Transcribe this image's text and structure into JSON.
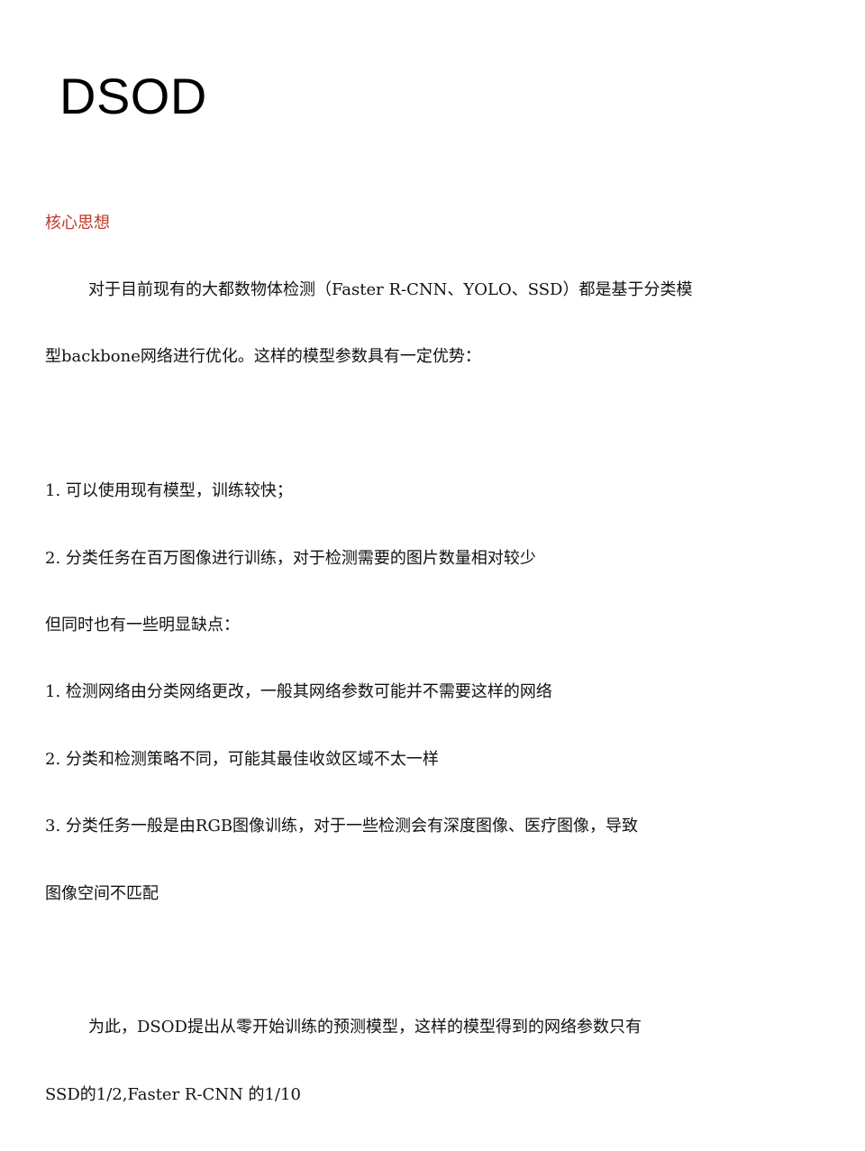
{
  "slide": {
    "title": "DSOD",
    "heading": "核心思想",
    "heading_color": "#c0392b",
    "lines": {
      "intro_1": "对于目前现有的大都数物体检测（Faster R-CNN、YOLO、SSD）都是基于分类模",
      "intro_2": "型backbone网络进行优化。这样的模型参数具有一定优势：",
      "adv_1": "1. 可以使用现有模型，训练较快；",
      "adv_2": "2. 分类任务在百万图像进行训练，对于检测需要的图片数量相对较少",
      "disadv_intro": "但同时也有一些明显缺点：",
      "disadv_1": "1. 检测网络由分类网络更改，一般其网络参数可能并不需要这样的网络",
      "disadv_2": "2. 分类和检测策略不同，可能其最佳收敛区域不太一样",
      "disadv_3a": "3. 分类任务一般是由RGB图像训练，对于一些检测会有深度图像、医疗图像，导致",
      "disadv_3b": "图像空间不匹配",
      "conclusion_1": "为此，DSOD提出从零开始训练的预测模型，这样的模型得到的网络参数只有",
      "conclusion_2": "SSD的1/2,Faster R-CNN 的1/10"
    }
  }
}
